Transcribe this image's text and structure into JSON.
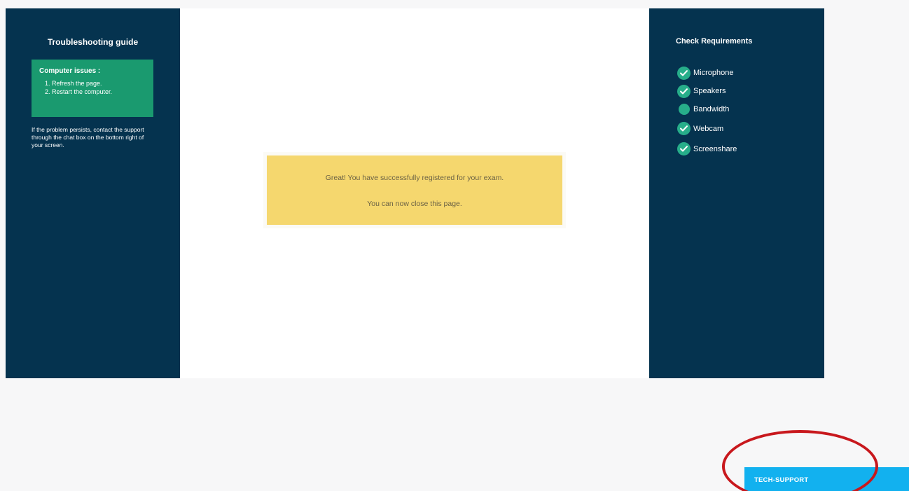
{
  "troubleshooting": {
    "title": "Troubleshooting guide",
    "issues_title": "Computer issues :",
    "steps": [
      "1. Refresh the page.",
      "2. Restart the computer."
    ],
    "persist_text": "If the problem persists, contact the support through the chat box on the bottom right of your screen."
  },
  "message": {
    "line1": "Great! You have successfully registered for your exam.",
    "line2": "You can now close this page."
  },
  "requirements": {
    "title": "Check Requirements",
    "items": [
      {
        "label": "Microphone",
        "status": "checked"
      },
      {
        "label": "Speakers",
        "status": "checked"
      },
      {
        "label": "Bandwidth",
        "status": "dot"
      },
      {
        "label": "Webcam",
        "status": "checked"
      },
      {
        "label": "Screenshare",
        "status": "checked"
      }
    ]
  },
  "support": {
    "button_label": "TECH-SUPPORT"
  },
  "colors": {
    "panel": "#05334f",
    "issue_box": "#1a9a6f",
    "message_box": "#f5d76e",
    "check": "#27ae8a",
    "support_button": "#12b1ef",
    "highlight": "#c8181d"
  }
}
